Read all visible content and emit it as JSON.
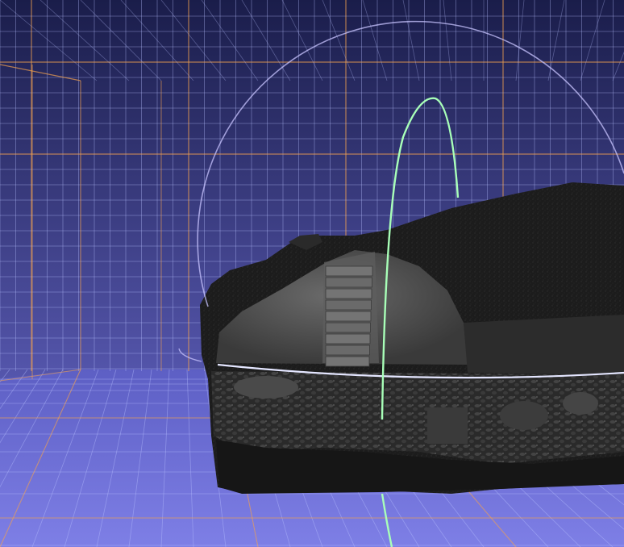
{
  "viewport": {
    "caption": "",
    "background_top": "#1a1d4a",
    "background_bottom": "#6f6fd8",
    "grid_minor_color": "#b8c0ff",
    "grid_major_color": "#f0a050",
    "trackball_vertical_color": "#a8ffb8",
    "trackball_horizontal_color": "#d8dcff",
    "trackball_outer_color": "#c8c4ff",
    "model_dark": "#1c1c1c",
    "model_light": "#505050"
  }
}
